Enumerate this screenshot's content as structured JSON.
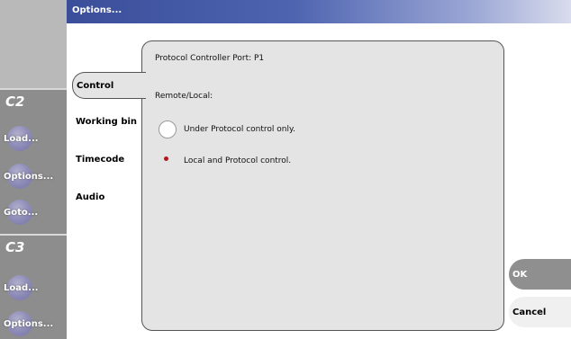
{
  "window": {
    "title": "Options..."
  },
  "channels": [
    {
      "label": "C2",
      "buttons": [
        "Load...",
        "Options...",
        "Goto..."
      ]
    },
    {
      "label": "C3",
      "buttons": [
        "Load...",
        "Options..."
      ]
    }
  ],
  "tabs": [
    {
      "label": "Control",
      "active": true
    },
    {
      "label": "Working bin",
      "active": false
    },
    {
      "label": "Timecode",
      "active": false
    },
    {
      "label": "Audio",
      "active": false
    }
  ],
  "panel": {
    "port_label": "Protocol Controller Port: P1",
    "section_label": "Remote/Local:",
    "options": [
      {
        "label": "Under Protocol control only.",
        "selected": false
      },
      {
        "label": "Local and Protocol control.",
        "selected": true
      }
    ]
  },
  "buttons": {
    "ok": "OK",
    "cancel": "Cancel"
  },
  "colors": {
    "accent_selected": "#b0181e",
    "titlebar": "#3a4e9a"
  }
}
